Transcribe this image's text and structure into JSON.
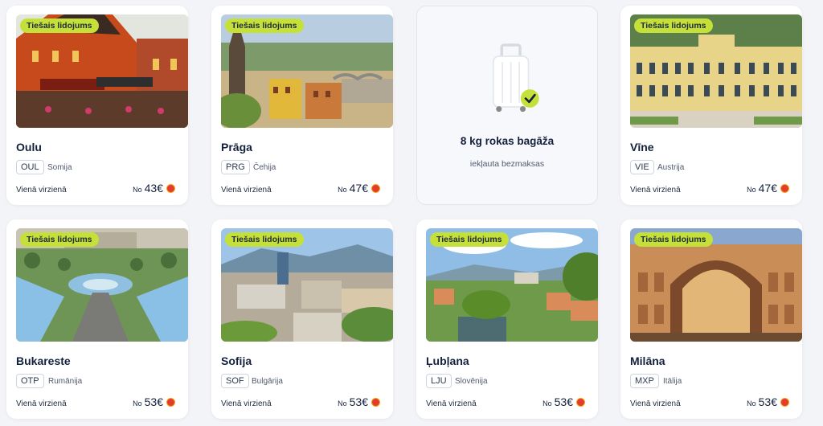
{
  "colors": {
    "badge": "#c6e03a",
    "text_dark": "#14213d",
    "card_bg": "#ffffff",
    "page_bg": "#f3f4f8"
  },
  "badge_text": "Tiešais lidojums",
  "direction_text": "Vienā virzienā",
  "price_prefix": "No",
  "currency": "€",
  "luggage": {
    "title": "8 kg rokas bagāža",
    "subtitle": "iekļauta bezmaksas",
    "icon": "suitcase-icon"
  },
  "cards": [
    {
      "city": "Oulu",
      "code": "OUL",
      "country": "Somija",
      "price": "43€"
    },
    {
      "city": "Prāga",
      "code": "PRG",
      "country": "Čehija",
      "price": "47€"
    },
    {
      "city": "Vīne",
      "code": "VIE",
      "country": "Austrija",
      "price": "47€"
    },
    {
      "city": "Bukareste",
      "code": "OTP",
      "country": "Rumānija",
      "price": "53€"
    },
    {
      "city": "Sofija",
      "code": "SOF",
      "country": "Bulgārija",
      "price": "53€"
    },
    {
      "city": "Ļubļana",
      "code": "LJU",
      "country": "Slovēnija",
      "price": "53€"
    },
    {
      "city": "Milāna",
      "code": "MXP",
      "country": "Itālija",
      "price": "53€"
    }
  ]
}
